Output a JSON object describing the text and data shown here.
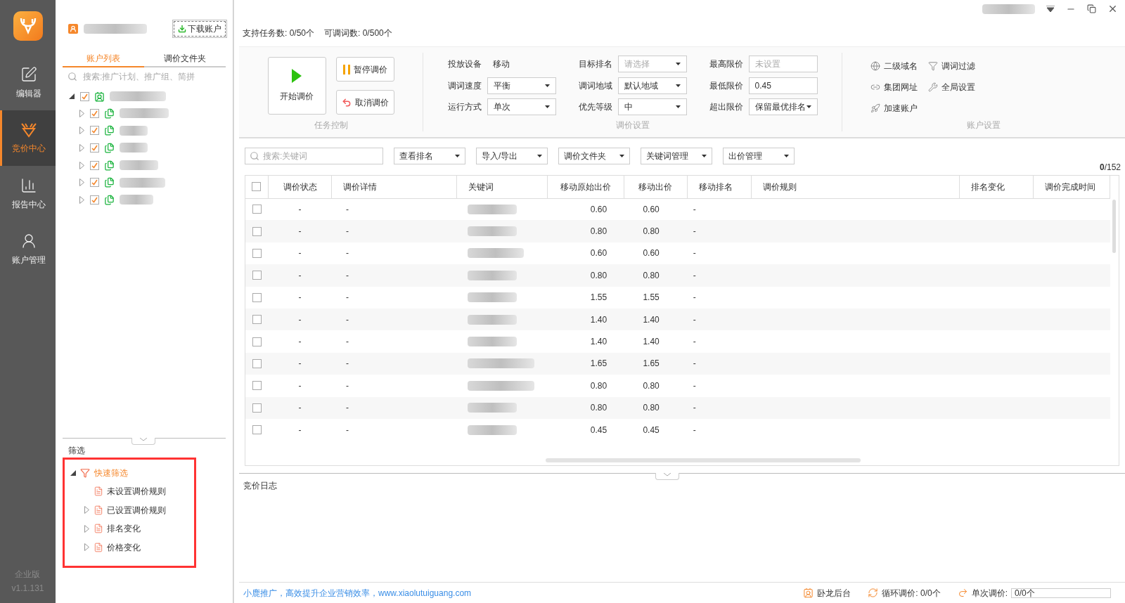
{
  "nav": {
    "items": [
      {
        "label": "编辑器",
        "kind": "edit",
        "selected": false
      },
      {
        "label": "竞价中心",
        "kind": "bid",
        "selected": true
      },
      {
        "label": "报告中心",
        "kind": "report",
        "selected": false
      },
      {
        "label": "账户管理",
        "kind": "account",
        "selected": false
      }
    ],
    "edition": "企业版",
    "version": "v1.1.131"
  },
  "account_panel": {
    "download_button": "下载账户",
    "tabs": [
      {
        "label": "账户列表",
        "selected": true
      },
      {
        "label": "调价文件夹",
        "selected": false
      }
    ],
    "search": {
      "placeholder": "搜索:推广计划、推广组、简拼"
    },
    "tree": [
      {
        "checked": true,
        "expanded": true,
        "children": [
          {
            "checked": true,
            "expanded": false
          },
          {
            "checked": true,
            "expanded": false
          },
          {
            "checked": true,
            "expanded": false
          },
          {
            "checked": true,
            "expanded": false
          },
          {
            "checked": true,
            "expanded": false
          },
          {
            "checked": true,
            "expanded": false
          }
        ]
      }
    ]
  },
  "filter": {
    "title": "筛选",
    "tree": [
      {
        "label": "快速筛选",
        "expanded": true,
        "children": [
          {
            "label": "未设置调价规则"
          },
          {
            "label": "已设置调价规则",
            "expanded": false
          },
          {
            "label": "排名变化",
            "expanded": false
          },
          {
            "label": "价格变化",
            "expanded": false
          }
        ]
      }
    ]
  },
  "stats": [
    "支持任务数: 0/50个",
    "可调词数: 0/500个"
  ],
  "task_control": {
    "title": "任务控制",
    "start": "开始调价",
    "pause": "暂停调价",
    "cancel": "取消调价"
  },
  "bid_settings": {
    "title": "调价设置",
    "fields": [
      {
        "label": "投放设备",
        "value": "移动",
        "kind": "text"
      },
      {
        "label": "调词速度",
        "value": "平衡",
        "kind": "select"
      },
      {
        "label": "运行方式",
        "value": "单次",
        "kind": "select"
      },
      {
        "label": "目标排名",
        "placeholder": "请选择",
        "kind": "select"
      },
      {
        "label": "调词地域",
        "value": "默认地域",
        "kind": "select"
      },
      {
        "label": "优先等级",
        "value": "中",
        "kind": "select"
      },
      {
        "label": "最高限价",
        "placeholder": "未设置",
        "kind": "input"
      },
      {
        "label": "最低限价",
        "value": "0.45",
        "kind": "input"
      },
      {
        "label": "超出限价",
        "value": "保留最优排名",
        "kind": "select"
      }
    ]
  },
  "account_settings": {
    "title": "账户设置",
    "items": [
      {
        "label": "二级域名",
        "kind": "globe"
      },
      {
        "label": "调词过滤",
        "kind": "filter"
      },
      {
        "label": "集团网址",
        "kind": "link"
      },
      {
        "label": "全局设置",
        "kind": "tools"
      },
      {
        "label": "加速账户",
        "kind": "rocket"
      }
    ]
  },
  "table_toolbar": {
    "search": {
      "placeholder": "搜索:关键词"
    },
    "menus": [
      "查看排名",
      "导入/导出",
      "调价文件夹",
      "关键词管理",
      "出价管理"
    ],
    "count": "**0**/152"
  },
  "table": {
    "select_all": false,
    "columns": [
      "调价状态",
      "调价详情",
      "关键词",
      "移动原始出价",
      "移动出价",
      "移动排名",
      "调价规则",
      "排名变化",
      "调价完成时间"
    ],
    "rows": [
      {
        "checked": false,
        "status": "-",
        "detail": "-",
        "original_bid": "0.60",
        "bid": "0.60",
        "rank": "-"
      },
      {
        "checked": false,
        "status": "-",
        "detail": "-",
        "original_bid": "0.80",
        "bid": "0.80",
        "rank": "-"
      },
      {
        "checked": false,
        "status": "-",
        "detail": "-",
        "original_bid": "0.60",
        "bid": "0.60",
        "rank": "-"
      },
      {
        "checked": false,
        "status": "-",
        "detail": "-",
        "original_bid": "0.80",
        "bid": "0.80",
        "rank": "-"
      },
      {
        "checked": false,
        "status": "-",
        "detail": "-",
        "original_bid": "1.55",
        "bid": "1.55",
        "rank": "-"
      },
      {
        "checked": false,
        "status": "-",
        "detail": "-",
        "original_bid": "1.40",
        "bid": "1.40",
        "rank": "-"
      },
      {
        "checked": false,
        "status": "-",
        "detail": "-",
        "original_bid": "1.40",
        "bid": "1.40",
        "rank": "-"
      },
      {
        "checked": false,
        "status": "-",
        "detail": "-",
        "original_bid": "1.65",
        "bid": "1.65",
        "rank": "-"
      },
      {
        "checked": false,
        "status": "-",
        "detail": "-",
        "original_bid": "0.80",
        "bid": "0.80",
        "rank": "-"
      },
      {
        "checked": false,
        "status": "-",
        "detail": "-",
        "original_bid": "0.80",
        "bid": "0.80",
        "rank": "-"
      },
      {
        "checked": false,
        "status": "-",
        "detail": "-",
        "original_bid": "0.45",
        "bid": "0.45",
        "rank": "-"
      }
    ]
  },
  "log": {
    "title": "竞价日志"
  },
  "status_bar": {
    "slogan": "小鹿推广，高效提升企业营销效率，www.xiaolutuiguang.com",
    "items": [
      {
        "label": "卧龙后台",
        "kind": "user"
      },
      {
        "label": "循环调价: 0/0个",
        "kind": "loop"
      },
      {
        "label": "单次调价:",
        "value": "0/0个",
        "level": 0,
        "kind": "once"
      }
    ]
  }
}
